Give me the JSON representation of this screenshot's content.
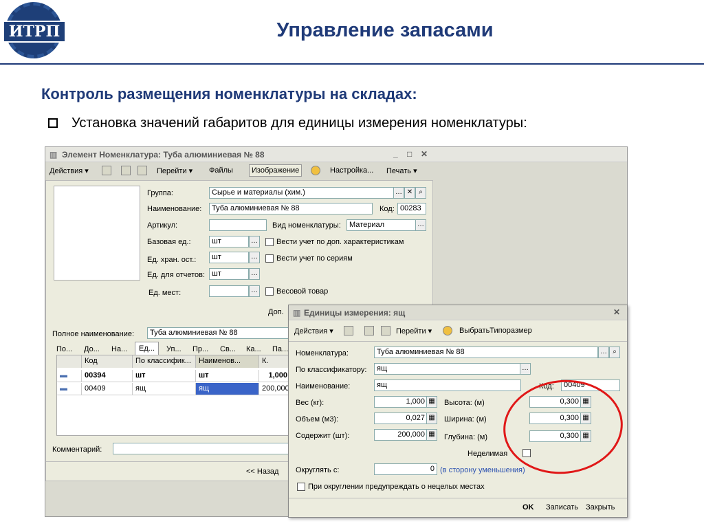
{
  "slide": {
    "logo": "ИТРП",
    "title": "Управление запасами",
    "subtitle": "Контроль размещения номенклатуры на складах:",
    "bullet": "Установка значений габаритов для единицы измерения номенклатуры:"
  },
  "win1": {
    "title": "Элемент Номенклатура: Туба алюминиевая № 88",
    "window_controls": {
      "minimize": "_",
      "maximize": "□",
      "close": "✕"
    },
    "toolbar": {
      "actions": "Действия ▾",
      "goto": "Перейти ▾",
      "files": "Файлы",
      "image": "Изображение",
      "settings": "Настройка...",
      "print": "Печать ▾"
    },
    "labels": {
      "group": "Группа:",
      "name": "Наименование:",
      "article": "Артикул:",
      "base_unit": "Базовая ед.:",
      "stock_unit": "Ед. хран. ост.:",
      "report_unit": "Ед. для отчетов:",
      "place_unit": "Ед. мест:",
      "code": "Код:",
      "kind": "Вид номенклатуры:",
      "dop": "Доп.",
      "full_name": "Полное наименование:",
      "comment": "Комментарий:"
    },
    "values": {
      "group": "Сырье и материалы (хим.)",
      "name": "Туба алюминиевая № 88",
      "code": "00283",
      "kind": "Материал",
      "base_unit": "шт",
      "stock_unit": "шт",
      "report_unit": "шт",
      "full_name": "Туба алюминиевая № 88"
    },
    "checkboxes": {
      "chars": "Вести учет по доп. характеристикам",
      "series": "Вести учет по сериям",
      "weight": "Весовой товар"
    },
    "tabs": [
      "По...",
      "До...",
      "На...",
      "Ед...",
      "Уп...",
      "Пр...",
      "Св...",
      "Ка...",
      "Па..."
    ],
    "table": {
      "headers": [
        "Код",
        "По классифик...",
        "Наименов...",
        "К."
      ],
      "rows": [
        {
          "code": "00394",
          "class": "шт",
          "name": "шт",
          "k": "1,000"
        },
        {
          "code": "00409",
          "class": "ящ",
          "name": "ящ",
          "k": "200,000"
        }
      ]
    },
    "back": "<< Назад"
  },
  "win2": {
    "title": "Единицы измерения: ящ",
    "close": "✕",
    "toolbar": {
      "actions": "Действия ▾",
      "goto": "Перейти ▾",
      "select": "ВыбратьТипоразмер"
    },
    "labels": {
      "nom": "Номенклатура:",
      "class": "По классификатору:",
      "name": "Наименование:",
      "code": "Код:",
      "weight": "Вес (кг):",
      "volume": "Объем (м3):",
      "contains": "Содержит (шт):",
      "height": "Высота: (м)",
      "width": "Ширина: (м)",
      "depth": "Глубина: (м)",
      "indivisible": "Неделимая",
      "round": "Округлять с:",
      "round_dir": "(в сторону уменьшения)",
      "warn": "При округлении предупреждать о нецелых местах"
    },
    "values": {
      "nom": "Туба алюминиевая № 88",
      "class": "ящ",
      "name": "ящ",
      "code": "00409",
      "weight": "1,000",
      "volume": "0,027",
      "contains": "200,000",
      "height": "0,300",
      "width": "0,300",
      "depth": "0,300",
      "round": "0"
    },
    "buttons": {
      "ok": "OK",
      "save": "Записать",
      "close": "Закрыть"
    }
  },
  "colors": {
    "title": "#1f3a78",
    "highlight": "#3a64c8",
    "circle": "#e01818"
  }
}
